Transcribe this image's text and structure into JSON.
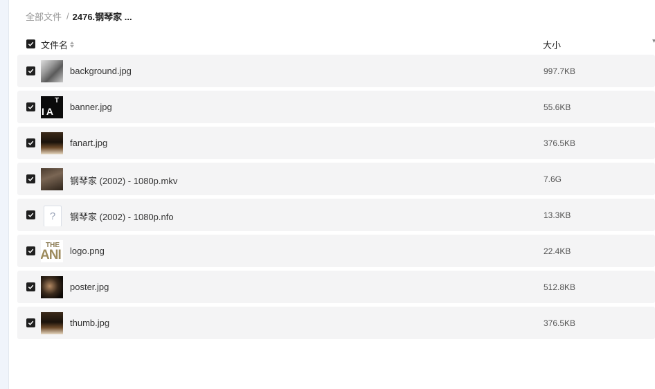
{
  "breadcrumb": {
    "root": "全部文件",
    "separator": "/",
    "current": "2476.钢琴家 ..."
  },
  "header": {
    "name_label": "文件名",
    "size_label": "大小",
    "more_symbol": "▾"
  },
  "files": [
    {
      "name": "background.jpg",
      "size": "997.7KB",
      "thumb": "image-thumbnail"
    },
    {
      "name": "banner.jpg",
      "size": "55.6KB",
      "thumb": "image-thumbnail"
    },
    {
      "name": "fanart.jpg",
      "size": "376.5KB",
      "thumb": "image-thumbnail"
    },
    {
      "name": "钢琴家 (2002) - 1080p.mkv",
      "size": "7.6G",
      "thumb": "video-thumbnail"
    },
    {
      "name": "钢琴家 (2002) - 1080p.nfo",
      "size": "13.3KB",
      "thumb": "unknown-file-icon"
    },
    {
      "name": "logo.png",
      "size": "22.4KB",
      "thumb": "image-thumbnail"
    },
    {
      "name": "poster.jpg",
      "size": "512.8KB",
      "thumb": "image-thumbnail"
    },
    {
      "name": "thumb.jpg",
      "size": "376.5KB",
      "thumb": "image-thumbnail"
    }
  ],
  "thumb_text": {
    "banner_big": "IA",
    "banner_small": "T",
    "nfo_glyph": "?",
    "logo_top": "THE",
    "logo_main": "ANI"
  },
  "colors": {
    "checkbox": "#1f1f1f",
    "row_background": "#f4f4f5",
    "muted_text": "#999999"
  }
}
